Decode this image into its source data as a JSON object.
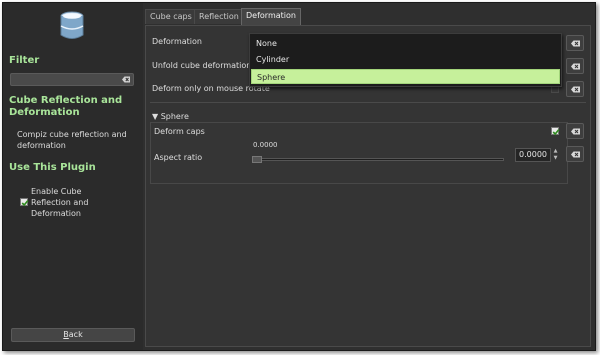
{
  "sidebar": {
    "filter_title": "Filter",
    "filter_value": "",
    "plugin_title": "Cube Reflection and Deformation",
    "plugin_description": "Compiz cube reflection and deformation",
    "use_title": "Use This Plugin",
    "enable_label": "Enable Cube Reflection and Deformation",
    "enable_checked": true,
    "back_label": "Back",
    "back_mnemonic": "B"
  },
  "tabs": [
    {
      "label": "Cube caps",
      "active": false
    },
    {
      "label": "Reflection",
      "active": false
    },
    {
      "label": "Deformation",
      "active": true
    }
  ],
  "settings": {
    "deformation_label": "Deformation",
    "unfold_label": "Unfold cube deformation",
    "mouse_rotate_label": "Deform only on mouse rotate",
    "section_label": "Sphere",
    "deform_caps_label": "Deform caps",
    "deform_caps_checked": true,
    "aspect_ratio_label": "Aspect ratio",
    "aspect_ratio_value_text": "0.0000",
    "aspect_ratio_spin": "0.0000",
    "aspect_ratio_value": 0.0
  },
  "dropdown": {
    "options": [
      "None",
      "Cylinder",
      "Sphere"
    ],
    "selected": "Sphere"
  },
  "colors": {
    "accent_green": "#a9e59a",
    "selection": "#c6f09b",
    "background": "#2f2f2f"
  }
}
